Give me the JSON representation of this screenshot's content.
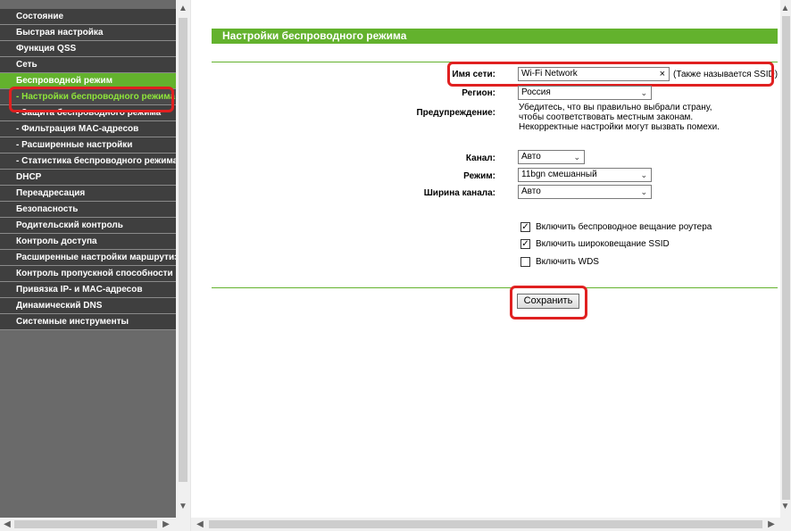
{
  "menu": {
    "items": [
      {
        "label": "Состояние",
        "type": "top"
      },
      {
        "label": "Быстрая настройка",
        "type": "top"
      },
      {
        "label": "Функция QSS",
        "type": "top"
      },
      {
        "label": "Сеть",
        "type": "top"
      },
      {
        "label": "Беспроводной режим",
        "type": "active-parent"
      },
      {
        "label": "- Настройки беспроводного режима",
        "type": "active"
      },
      {
        "label": "- Защита беспроводного режима",
        "type": "sub"
      },
      {
        "label": "- Фильтрация MAC-адресов",
        "type": "sub"
      },
      {
        "label": "- Расширенные настройки",
        "type": "sub"
      },
      {
        "label": "- Статистика беспроводного режима",
        "type": "sub"
      },
      {
        "label": "DHCP",
        "type": "top"
      },
      {
        "label": "Переадресация",
        "type": "top"
      },
      {
        "label": "Безопасность",
        "type": "top"
      },
      {
        "label": "Родительский контроль",
        "type": "top"
      },
      {
        "label": "Контроль доступа",
        "type": "top"
      },
      {
        "label": "Расширенные настройки маршрутизации",
        "type": "top"
      },
      {
        "label": "Контроль пропускной способности",
        "type": "top"
      },
      {
        "label": "Привязка IP- и MAC-адресов",
        "type": "top"
      },
      {
        "label": "Динамический DNS",
        "type": "top"
      },
      {
        "label": "Системные инструменты",
        "type": "top"
      }
    ]
  },
  "page": {
    "title": "Настройки беспроводного режима"
  },
  "form": {
    "ssid_label": "Имя сети:",
    "ssid_value": "Wi-Fi Network",
    "ssid_clear": "×",
    "ssid_hint": "(Также называется SSID)",
    "region_label": "Регион:",
    "region_value": "Россия",
    "warning_label": "Предупреждение:",
    "warning_line1": "Убедитесь, что вы правильно выбрали страну,",
    "warning_line2": "чтобы соответствовать местным законам.",
    "warning_line3": "Некорректные настройки могут вызвать помехи.",
    "channel_label": "Канал:",
    "channel_value": "Авто",
    "mode_label": "Режим:",
    "mode_value": "11bgn смешанный",
    "width_label": "Ширина канала:",
    "width_value": "Авто",
    "cb1_label": "Включить беспроводное вещание роутера",
    "cb2_label": "Включить широковещание SSID",
    "cb3_label": "Включить WDS",
    "save_label": "Сохранить"
  },
  "checks": {
    "cb1": "✓",
    "cb2": "✓",
    "cb3": ""
  },
  "colors": {
    "accent": "#63b22d",
    "sidebar": "#3f3f3f",
    "highlight": "#e02020"
  }
}
